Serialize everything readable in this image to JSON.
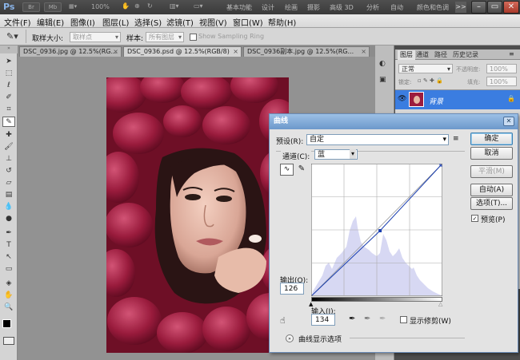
{
  "titlebar": {
    "app": "Ps",
    "zoom": "100%",
    "workspaces": [
      "基本功能",
      "设计",
      "绘画",
      "摄影",
      "高级 3D",
      "分析",
      "自动",
      "颜色和色调"
    ],
    "overflow": ">>"
  },
  "menubar": {
    "items": [
      "文件(F)",
      "编辑(E)",
      "图像(I)",
      "图层(L)",
      "选择(S)",
      "滤镜(T)",
      "视图(V)",
      "窗口(W)",
      "帮助(H)"
    ]
  },
  "options": {
    "sample_size_label": "取样大小:",
    "sample_size_value": "取样点",
    "sample_label": "样本:",
    "sample_value": "所有图层",
    "show_ring": "Show Sampling Ring"
  },
  "doc_tabs": [
    {
      "label": "DSC_0936.jpg @ 12.5%(RG...",
      "active": false
    },
    {
      "label": "DSC_0936.psd @ 12.5%(RGB/8)",
      "active": true
    },
    {
      "label": "DSC_0936副本.jpg @ 12.5%(RG...",
      "active": false
    }
  ],
  "layers_panel": {
    "tabs": [
      "图层",
      "通道",
      "路径",
      "历史记录"
    ],
    "blend_mode": "正常",
    "opacity_label": "不透明度:",
    "opacity_value": "100%",
    "lock_label": "锁定:",
    "fill_label": "填充:",
    "fill_value": "100%",
    "layer_name": "背景"
  },
  "curves": {
    "title": "曲线",
    "preset_label": "预设(R):",
    "preset_value": "自定",
    "channel_label": "通道(C):",
    "channel_value": "蓝",
    "output_label": "输出(O):",
    "output_value": "126",
    "input_label": "输入(I):",
    "input_value": "134",
    "show_clipping": "显示修剪(W)",
    "display_options": "曲线显示选项",
    "buttons": {
      "ok": "确定",
      "cancel": "取消",
      "smooth": "平滑(M)",
      "auto": "自动(A)",
      "options": "选项(T)..."
    },
    "preview_label": "预览(P)",
    "preview_checked": true,
    "curve_points": [
      [
        0,
        0
      ],
      [
        134,
        126
      ],
      [
        255,
        255
      ]
    ]
  },
  "colors": {
    "accent": "#1e73d2",
    "layer_selected": "#3b7de0",
    "rose": "#8c1a34"
  }
}
